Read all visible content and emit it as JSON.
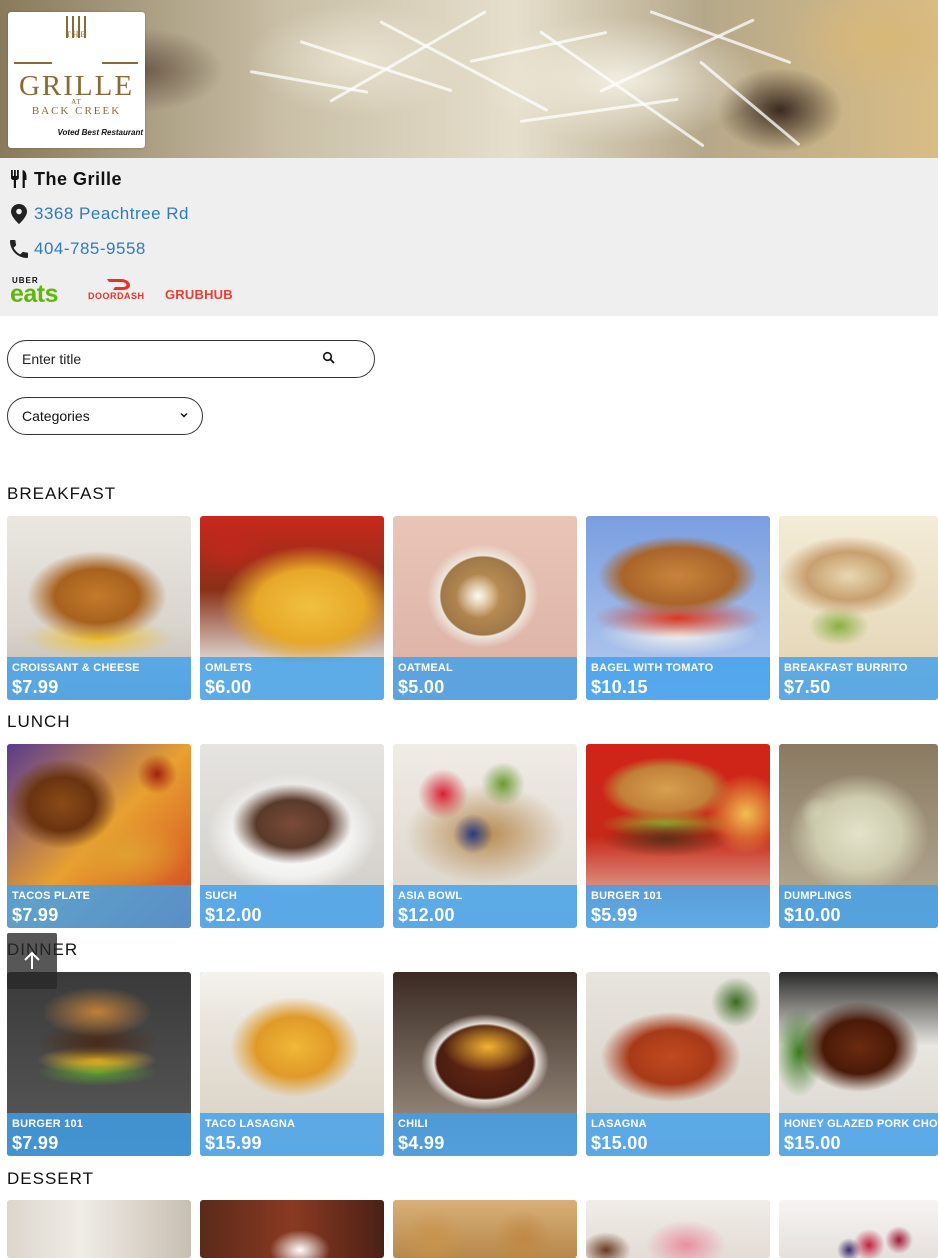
{
  "logo": {
    "the": "THE",
    "grille": "GRILLE",
    "at": "AT",
    "back_creek": "BACK CREEK",
    "tagline": "Voted Best Restaurant"
  },
  "restaurant": {
    "name": "The Grille",
    "address": "3368 Peachtree Rd",
    "phone": "404-785-9558"
  },
  "delivery": {
    "uber_top": "UBER",
    "uber_eats": "eats",
    "doordash": "DOORDASH",
    "grubhub": "GRUBHUB"
  },
  "search": {
    "placeholder": "Enter title"
  },
  "categories": {
    "selected": "Categories"
  },
  "sections": [
    {
      "title": "BREAKFAST",
      "items": [
        {
          "name": "CROISSANT & CHEESE",
          "price": "$7.99"
        },
        {
          "name": "OMLETS",
          "price": "$6.00"
        },
        {
          "name": "OATMEAL",
          "price": "$5.00"
        },
        {
          "name": "BAGEL WITH TOMATO",
          "price": "$10.15"
        },
        {
          "name": "BREAKFAST BURRITO",
          "price": "$7.50"
        }
      ]
    },
    {
      "title": "LUNCH",
      "items": [
        {
          "name": "TACOS PLATE",
          "price": "$7.99"
        },
        {
          "name": "SUCH",
          "price": "$12.00"
        },
        {
          "name": "ASIA BOWL",
          "price": "$12.00"
        },
        {
          "name": "BURGER 101",
          "price": "$5.99"
        },
        {
          "name": "DUMPLINGS",
          "price": "$10.00"
        }
      ]
    },
    {
      "title": "DINNER",
      "items": [
        {
          "name": "BURGER 101",
          "price": "$7.99"
        },
        {
          "name": "TACO LASAGNA",
          "price": "$15.99"
        },
        {
          "name": "CHILI",
          "price": "$4.99"
        },
        {
          "name": "LASAGNA",
          "price": "$15.00"
        },
        {
          "name": "HONEY GLAZED PORK CHOPS",
          "price": "$15.00"
        }
      ]
    },
    {
      "title": "DESSERT",
      "items": [
        {
          "name": "",
          "price": ""
        },
        {
          "name": "",
          "price": ""
        },
        {
          "name": "",
          "price": ""
        },
        {
          "name": "",
          "price": ""
        },
        {
          "name": "",
          "price": ""
        }
      ]
    }
  ],
  "colors": {
    "link": "#2f7bc1",
    "card_band": "#40a0eb",
    "uber_green": "#5fb709",
    "doordash_red": "#ea3125",
    "grubhub_red": "#e93f33",
    "info_bg": "#efefef"
  },
  "icons": {
    "restaurant": "fork-knife-icon",
    "address": "map-pin-icon",
    "phone": "phone-icon",
    "search": "search-icon",
    "categories": "chevron-down-icon",
    "back_to_top": "arrow-up-icon"
  }
}
